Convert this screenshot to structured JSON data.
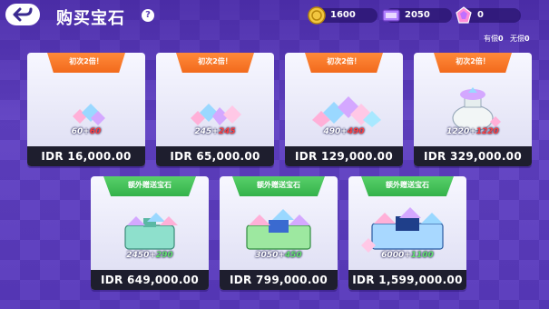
{
  "header": {
    "title": "购买宝石",
    "help_label": "?"
  },
  "currencies": [
    {
      "icon": "coin-icon",
      "value": "1600",
      "color": "#f2c640"
    },
    {
      "icon": "ticket-icon",
      "value": "2050",
      "color": "#b080ff"
    },
    {
      "icon": "gem-icon",
      "value": "0",
      "color": "#ff8ad8"
    }
  ],
  "filters": {
    "paid_label": "有偿",
    "paid_value": "0",
    "free_label": "无偿",
    "free_value": "0"
  },
  "offers_row1": [
    {
      "ribbon": "初次2倍！",
      "base": "60+",
      "bonus": "60",
      "price": "IDR 16,000.00"
    },
    {
      "ribbon": "初次2倍！",
      "base": "245+",
      "bonus": "245",
      "price": "IDR 65,000.00"
    },
    {
      "ribbon": "初次2倍！",
      "base": "490+",
      "bonus": "490",
      "price": "IDR 129,000.00"
    },
    {
      "ribbon": "初次2倍！",
      "base": "1220+",
      "bonus": "1220",
      "price": "IDR 329,000.00"
    }
  ],
  "offers_row2": [
    {
      "ribbon": "额外赠送宝石",
      "base": "2450+",
      "bonus": "290",
      "price": "IDR 649,000.00"
    },
    {
      "ribbon": "额外赠送宝石",
      "base": "3050+",
      "bonus": "450",
      "price": "IDR 799,000.00"
    },
    {
      "ribbon": "额外赠送宝石",
      "base": "6000+",
      "bonus": "1100",
      "price": "IDR 1,599,000.00"
    }
  ]
}
